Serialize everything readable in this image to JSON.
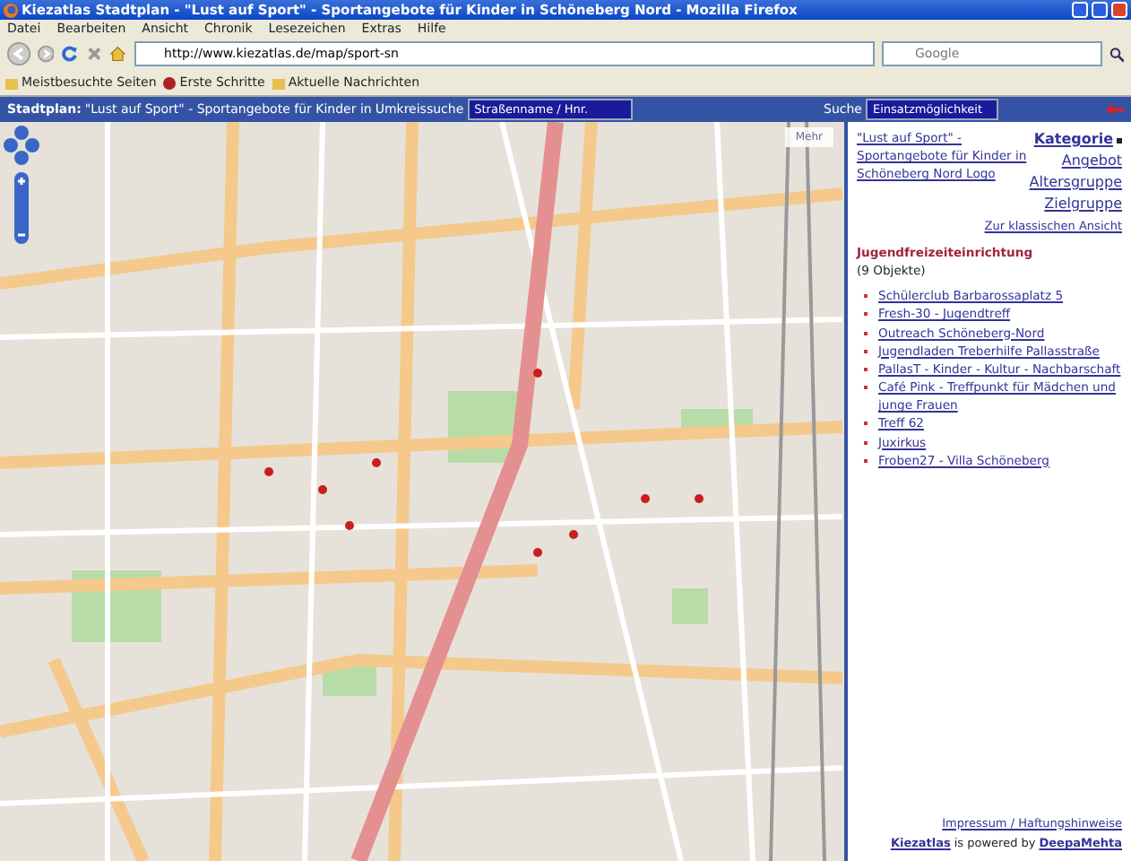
{
  "window": {
    "title": "Kiezatlas Stadtplan - \"Lust auf Sport\" - Sportangebote für Kinder in Schöneberg Nord - Mozilla Firefox"
  },
  "menu": [
    "Datei",
    "Bearbeiten",
    "Ansicht",
    "Chronik",
    "Lesezeichen",
    "Extras",
    "Hilfe"
  ],
  "toolbar": {
    "url": "http://www.kiezatlas.de/map/sport-sn",
    "search_placeholder": "Google"
  },
  "bookmarks": [
    "Meistbesuchte Seiten",
    "Erste Schritte",
    "Aktuelle Nachrichten"
  ],
  "app_header": {
    "label": "Stadtplan:",
    "title": "\"Lust auf Sport\" - Sportangebote für Kinder in",
    "radius_label": "Umkreissuche",
    "radius_value": "Straßenname / Hnr.",
    "search_label": "Suche",
    "search_value": "Einsatzmöglichkeit"
  },
  "map": {
    "layer_switcher": "Mehr"
  },
  "sidebar": {
    "logo_link": "\"Lust auf Sport\" - Sportangebote für Kinder in Schöneberg Nord Logo",
    "nav": [
      {
        "label": "Kategorie",
        "selected": true
      },
      {
        "label": "Angebot",
        "selected": false
      },
      {
        "label": "Altersgruppe",
        "selected": false
      },
      {
        "label": "Zielgruppe",
        "selected": false
      }
    ],
    "classic_link": "Zur klassischen Ansicht",
    "category": "Jugendfreizeiteinrichtung",
    "count": "(9 Objekte)",
    "items": [
      "Schülerclub Barbarossaplatz 5",
      "Fresh-30 - Jugendtreff",
      "Outreach Schöneberg-Nord",
      "Jugendladen Treberhilfe Pallasstraße",
      "PallasT - Kinder - Kultur - Nachbarschaft",
      "Café Pink - Treffpunkt für Mädchen und junge Frauen",
      "Treff 62",
      "Juxirkus",
      "Froben27 - Villa Schöneberg"
    ],
    "footer_link": "Impressum / Haftungshinweise",
    "powered": [
      {
        "text": "Kiezatlas",
        "link": true
      },
      {
        "text": "is powered by",
        "link": false
      },
      {
        "text": "DeepaMehta",
        "link": true
      }
    ]
  }
}
